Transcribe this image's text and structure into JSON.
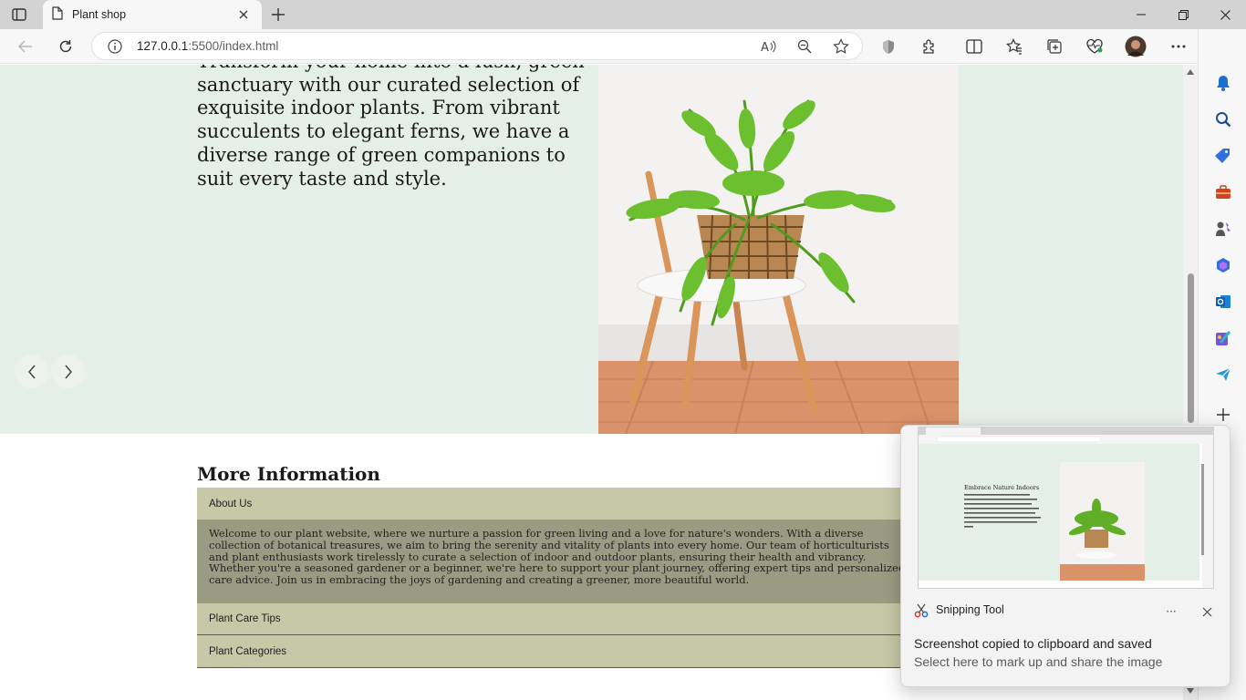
{
  "browser": {
    "tab_title": "Plant shop",
    "url_host": "127.0.0.1",
    "url_path": ":5500/index.html"
  },
  "hero": {
    "text": "Transform your home into a lush, green sanctuary with our curated selection of exquisite indoor plants. From vibrant succulents to elegant ferns, we have a diverse range of green companions to suit every taste and style."
  },
  "more_info": {
    "heading": "More Information",
    "sections": [
      {
        "label": "About Us"
      },
      {
        "label": "Plant Care Tips"
      },
      {
        "label": "Plant Categories"
      }
    ],
    "about_text": "Welcome to our plant website, where we nurture a passion for green living and a love for nature's wonders. With a diverse collection of botanical treasures, we aim to bring the serenity and vitality of plants into every home. Our team of horticulturists and plant enthusiasts work tirelessly to curate a selection of indoor and outdoor plants, ensuring their health and vibrancy. Whether you're a seasoned gardener or a beginner, we're here to support your plant journey, offering expert tips and personalized care advice. Join us in embracing the joys of gardening and creating a greener, more beautiful world."
  },
  "notification": {
    "app_name": "Snipping Tool",
    "title": "Screenshot copied to clipboard and saved",
    "subtitle": "Select here to mark up and share the image",
    "more_label": "···",
    "thumb_heading": "Embrace Nature Indoors"
  },
  "colors": {
    "hero_bg": "#e4efe7",
    "accordion_header": "#c6c8a7",
    "accordion_body": "#9a9b83",
    "edge_accent": "#1b6fd1"
  }
}
